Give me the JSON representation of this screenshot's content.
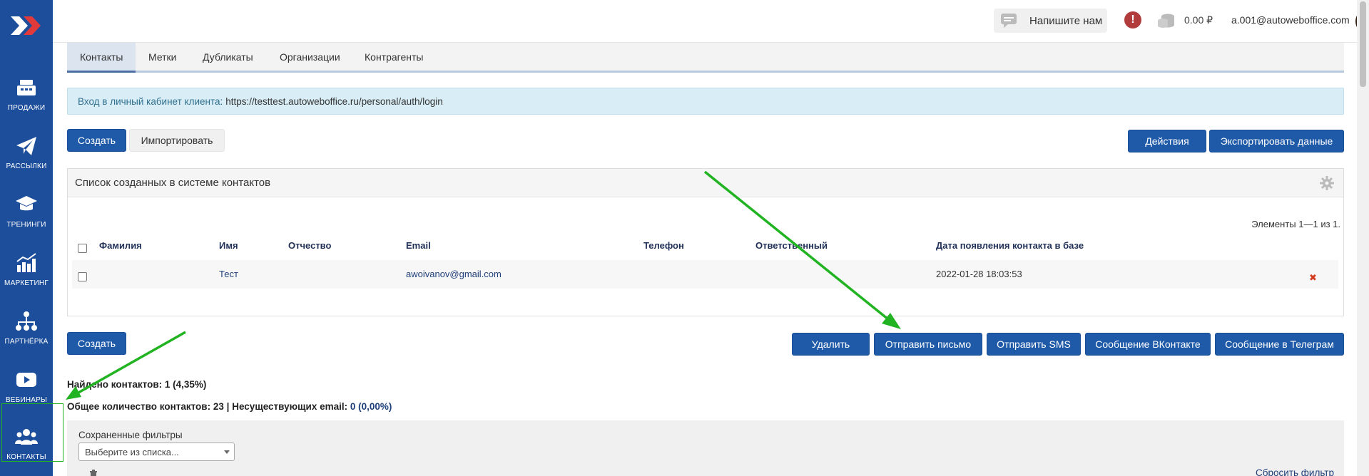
{
  "sidebar": {
    "items": [
      {
        "label": "ПРОДАЖИ",
        "icon": "cash-register-icon"
      },
      {
        "label": "РАССЫЛКИ",
        "icon": "paper-plane-icon"
      },
      {
        "label": "ТРЕНИНГИ",
        "icon": "graduation-cap-icon"
      },
      {
        "label": "МАРКЕТИНГ",
        "icon": "chart-icon"
      },
      {
        "label": "ПАРТНЁРКА",
        "icon": "network-icon"
      },
      {
        "label": "ВЕБИНАРЫ",
        "icon": "play-icon"
      },
      {
        "label": "КОНТАКТЫ",
        "icon": "users-icon"
      }
    ]
  },
  "topbar": {
    "write_us": "Напишите нам",
    "balance": "0.00 ₽",
    "user_email": "a.001@autoweboffice.com",
    "alert_glyph": "!"
  },
  "tabs": [
    "Контакты",
    "Метки",
    "Дубликаты",
    "Организации",
    "Контрагенты"
  ],
  "info": {
    "label": "Вход в личный кабинет клиента:",
    "url": "https://testtest.autoweboffice.ru/personal/auth/login"
  },
  "actions": {
    "create": "Создать",
    "import": "Импортировать",
    "actions": "Действия",
    "export": "Экспортировать данные"
  },
  "panel": {
    "title": "Список созданных в системе контактов",
    "items_count": "Элементы 1—1 из 1.",
    "columns": [
      "Фамилия",
      "Имя",
      "Отчество",
      "Email",
      "Телефон",
      "Ответственный",
      "Дата появления контакта в базе"
    ],
    "rows": [
      {
        "last_name": "",
        "first_name": "Тест",
        "middle_name": "",
        "email": "awoivanov@gmail.com",
        "phone": "",
        "responsible": "",
        "date": "2022-01-28 18:03:53",
        "delete_glyph": "✖"
      }
    ]
  },
  "bottom_actions": {
    "create": "Создать",
    "delete": "Удалить",
    "send_email": "Отправить письмо",
    "send_sms": "Отправить SMS",
    "vk": "Сообщение ВКонтакте",
    "telegram": "Сообщение в Телеграм"
  },
  "stats": {
    "found_label": "Найдено контактов:",
    "found_value": "1 (4,35%)",
    "total_label": "Общее количество контактов:",
    "total_value": "23",
    "separator": "|",
    "invalid_label": "Несуществующих email:",
    "invalid_value": "0 (0,00%)"
  },
  "filters": {
    "label": "Сохраненные фильтры",
    "select_placeholder": "Выберите из списка...",
    "reset": "Сбросить фильтр"
  },
  "colors": {
    "sidebar": "#1d4e9b",
    "primary": "#1f5aa8",
    "arrow": "#22b322"
  }
}
